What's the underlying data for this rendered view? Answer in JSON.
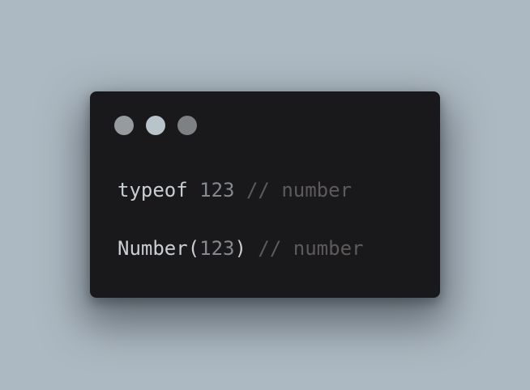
{
  "theme": {
    "background": "#adb9c2",
    "window_bg": "#19191b",
    "text": "#c9ced2",
    "number": "#85898d",
    "comment": "#5e5a5a"
  },
  "window_controls": [
    {
      "name": "window-dot-1",
      "color": "#959b9f"
    },
    {
      "name": "window-dot-2",
      "color": "#b8c4ca"
    },
    {
      "name": "window-dot-3",
      "color": "#7e8184"
    }
  ],
  "code": {
    "line1": {
      "keyword": "typeof",
      "number": "123",
      "comment": "// number"
    },
    "line2": {
      "func": "Number(",
      "number": "123",
      "close": ")",
      "comment": "// number"
    }
  }
}
